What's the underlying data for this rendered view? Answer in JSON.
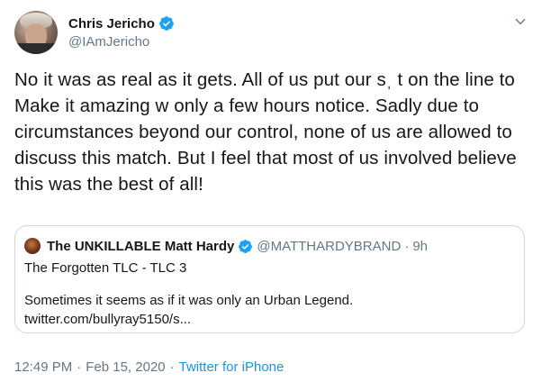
{
  "author": {
    "display_name": "Chris Jericho",
    "handle": "@IAmJericho"
  },
  "tweet": {
    "text": "No it was as real as it gets. All of us put our sˌ t on the line to Make it amazing w only a few hours notice. Sadly due to circumstances beyond our control, none of us are allowed to discuss this match. But I feel that most of us involved believe this was the best of all!",
    "time": "12:49 PM",
    "date": "Feb 15, 2020",
    "separator": "·",
    "source": "Twitter for iPhone"
  },
  "quoted": {
    "display_name": "The UNKILLABLE Matt Hardy",
    "handle": "@MATTHARDYBRAND",
    "separator": "·",
    "age": "9h",
    "line1": "The Forgotten TLC - TLC 3",
    "line2": "Sometimes it seems as if it was only an Urban Legend.",
    "line3": "twitter.com/bullyray5150/s..."
  },
  "icons": {
    "verified": "verified-badge-icon",
    "menu": "chevron-down-icon"
  },
  "colors": {
    "verified_blue": "#1da1f2",
    "secondary_text": "#657786",
    "link": "#1b95e0",
    "border": "#ccd6dd"
  }
}
